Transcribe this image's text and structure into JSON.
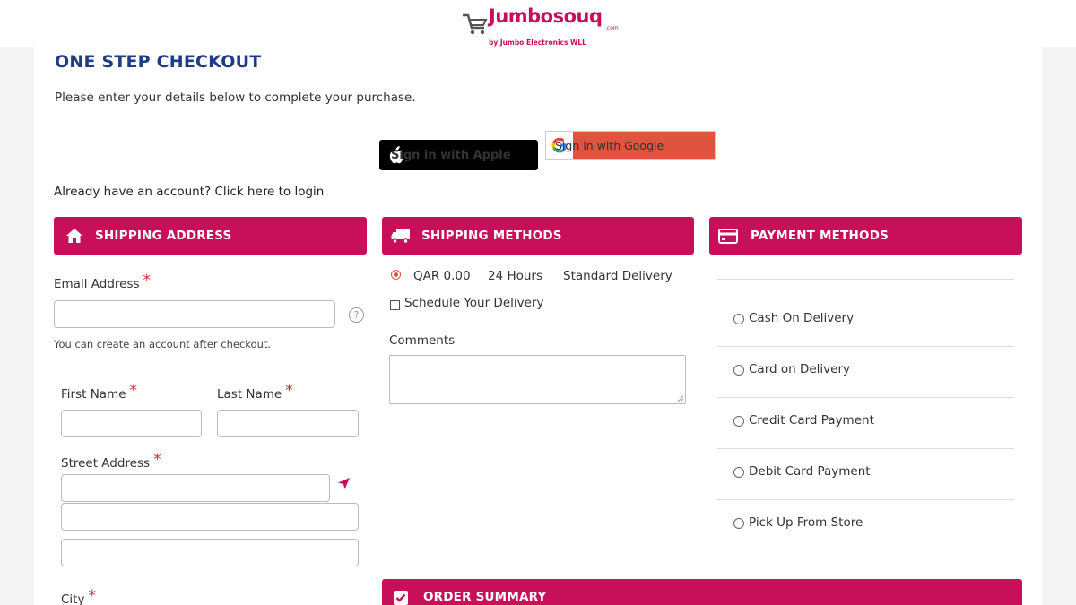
{
  "brand": {
    "logo_main": "Jumbosouq",
    "logo_com": ".com",
    "logo_sub": "by Jumbo Electronics WLL",
    "accent": "#c8105a",
    "title_color": "#1f3c88"
  },
  "page": {
    "title": "ONE STEP CHECKOUT",
    "intro": "Please enter your details below to complete your purchase.",
    "login_text": "Already have an account? Click here to login"
  },
  "social": {
    "apple_label": "Sign in with Apple",
    "google_label": "Sign in with Google"
  },
  "shipping_address": {
    "heading": "SHIPPING ADDRESS",
    "icon": "home-icon",
    "email_label": "Email Address",
    "email_value": "",
    "email_note": "You can create an account after checkout.",
    "first_name_label": "First Name",
    "last_name_label": "Last Name",
    "street_label": "Street Address",
    "city_label": "City",
    "required_mark": "*",
    "help_glyph": "?"
  },
  "shipping_methods": {
    "heading": "SHIPPING METHODS",
    "icon": "truck-icon",
    "option_price": "QAR 0.00",
    "option_time": "24 Hours",
    "option_name": "Standard Delivery",
    "schedule_label": "Schedule Your Delivery",
    "comments_label": "Comments"
  },
  "payment_methods": {
    "heading": "PAYMENT METHODS",
    "icon": "credit-card-icon",
    "options": [
      "Cash On Delivery",
      "Card on Delivery",
      "Credit Card Payment",
      "Debit Card Payment",
      "Pick Up From Store"
    ]
  },
  "order_summary": {
    "heading": "ORDER SUMMARY",
    "icon": "checkbox-checked-icon"
  }
}
